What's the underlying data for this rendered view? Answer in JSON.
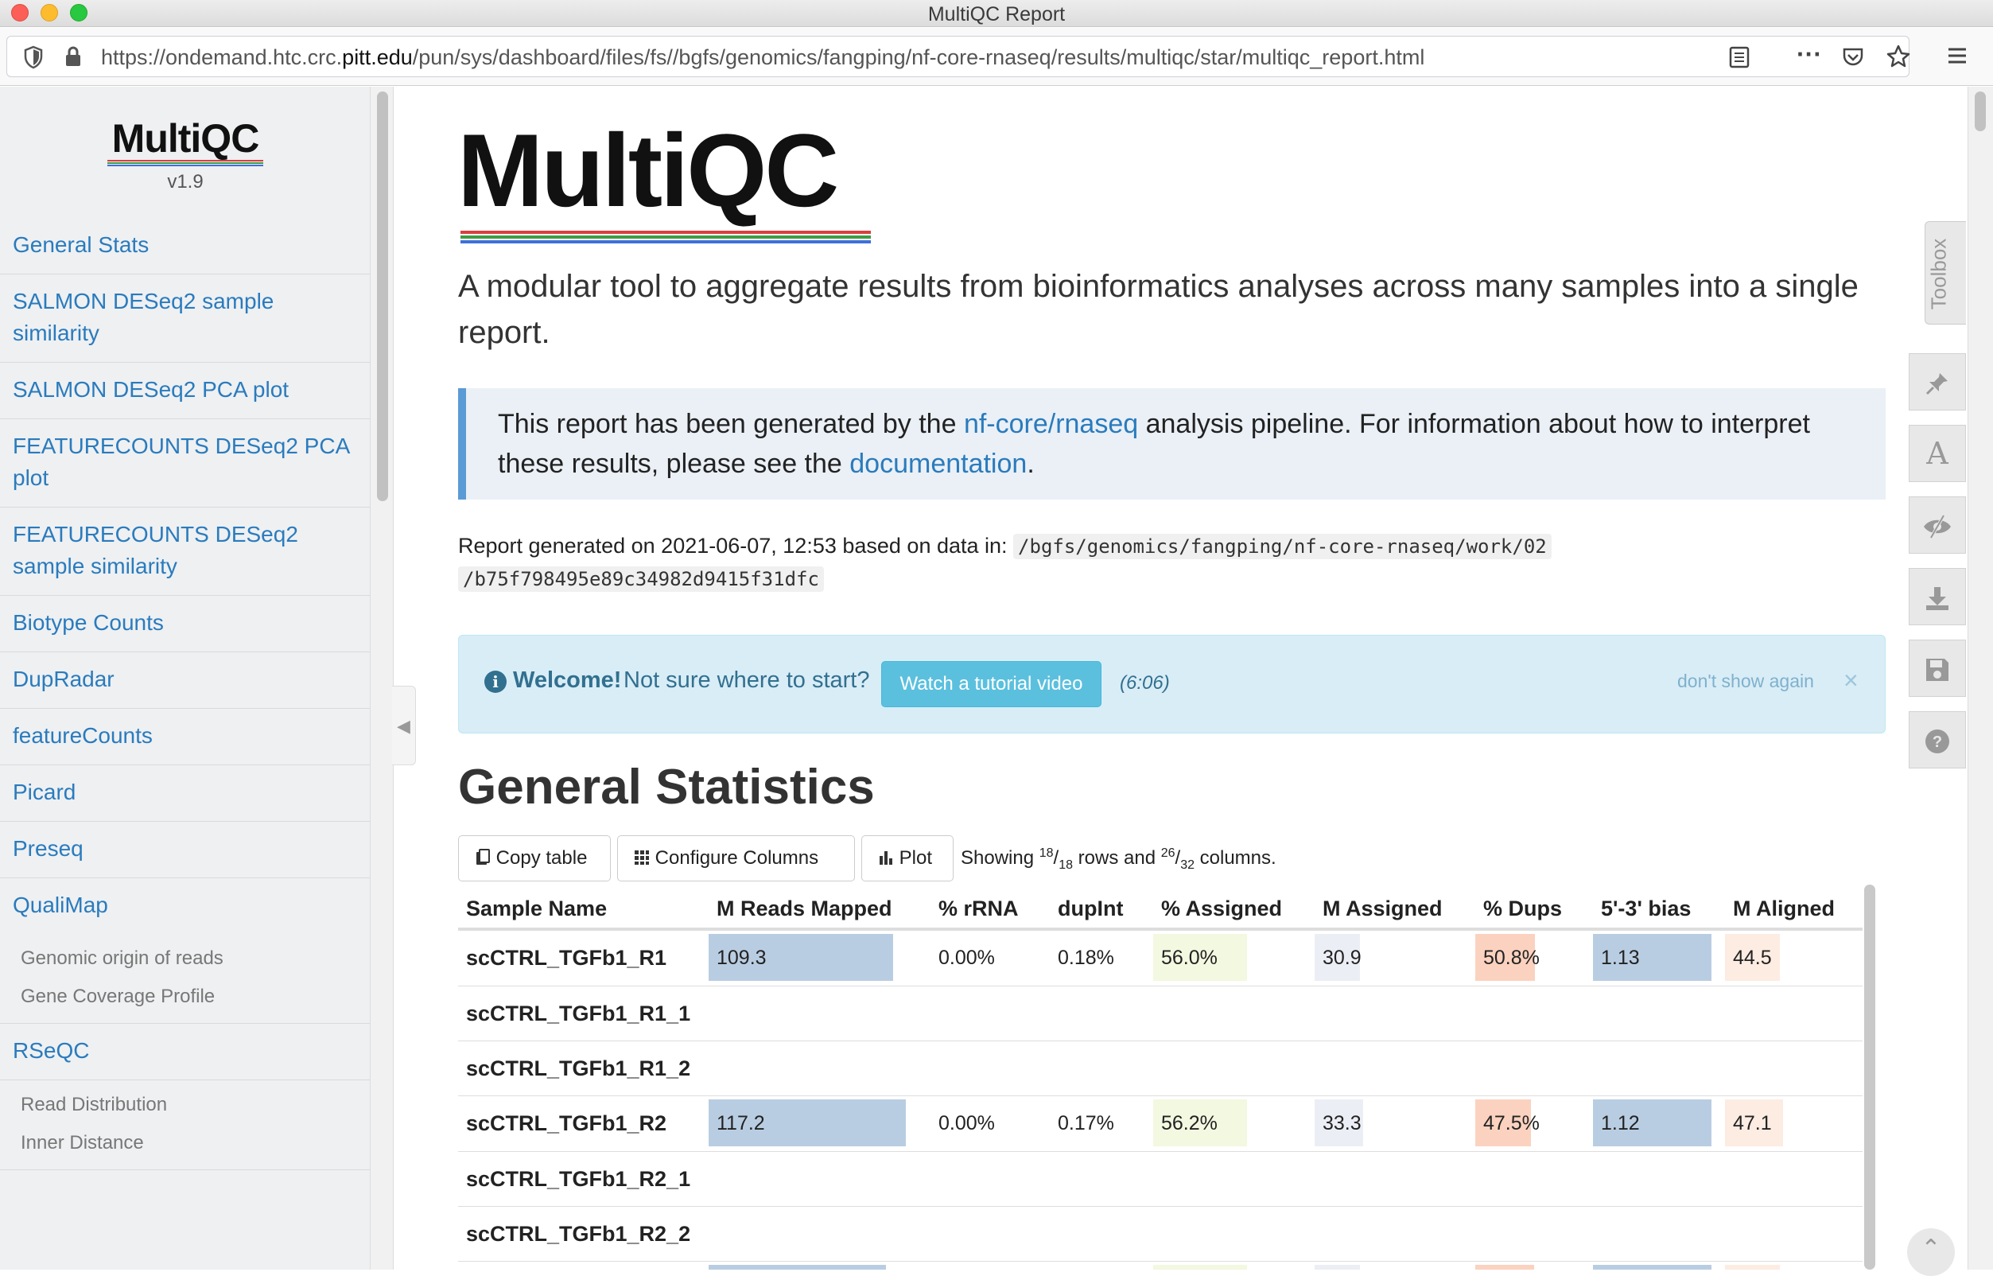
{
  "window": {
    "title": "MultiQC Report"
  },
  "browser": {
    "url_pre": "https://ondemand.htc.crc.",
    "url_host": "pitt.edu",
    "url_post": "/pun/sys/dashboard/files/fs//bgfs/genomics/fangping/nf-core-rnaseq/results/multiqc/star/multiqc_report.html"
  },
  "sidebar": {
    "logo_text": "MultiQC",
    "version": "v1.9",
    "items": [
      {
        "label": "General Stats"
      },
      {
        "label": "SALMON DESeq2 sample similarity"
      },
      {
        "label": "SALMON DESeq2 PCA plot"
      },
      {
        "label": "FEATURECOUNTS DESeq2 PCA plot"
      },
      {
        "label": "FEATURECOUNTS DESeq2 sample similarity"
      },
      {
        "label": "Biotype Counts"
      },
      {
        "label": "DupRadar"
      },
      {
        "label": "featureCounts"
      },
      {
        "label": "Picard"
      },
      {
        "label": "Preseq"
      },
      {
        "label": "QualiMap"
      },
      {
        "label": "RSeQC"
      }
    ],
    "qualimap_sub": [
      "Genomic origin of reads",
      "Gene Coverage Profile"
    ],
    "rseqc_sub": [
      "Read Distribution",
      "Inner Distance"
    ]
  },
  "main": {
    "logo_text": "MultiQC",
    "lead": "A modular tool to aggregate results from bioinformatics analyses across many samples into a single report.",
    "intro": {
      "t1": "This report has been generated by the ",
      "link1": "nf-core/rnaseq",
      "t2": " analysis pipeline. For information about how to interpret these results, please see the ",
      "link2": "documentation",
      "t3": "."
    },
    "generated": {
      "text": "Report generated on 2021-06-07, 12:53 based on data in: ",
      "path1": "/bgfs/genomics/fangping/nf-core-rnaseq/work/02",
      "path2": "/b75f798495e89c34982d9415f31dfc"
    },
    "welcome": {
      "strong": "Welcome!",
      "text": "Not sure where to start?",
      "button": "Watch a tutorial video",
      "duration": "(6:06)",
      "dismiss": "don't show again",
      "close": "×"
    },
    "heading": "General Statistics",
    "toolbar": {
      "copy": "Copy table",
      "configure": "Configure Columns",
      "plot": "Plot",
      "showing_pre": "Showing ",
      "rows_shown": "18",
      "rows_total": "18",
      "showing_mid": " rows and ",
      "cols_shown": "26",
      "cols_total": "32",
      "showing_post": " columns."
    }
  },
  "table": {
    "headers": [
      "Sample Name",
      "M Reads Mapped",
      "% rRNA",
      "dupInt",
      "% Assigned",
      "M Assigned",
      "% Dups",
      "5'-3' bias",
      "M Aligned"
    ],
    "rows": [
      {
        "name": "scCTRL_TGFb1_R1",
        "mapped": "109.3",
        "rrna": "0.00%",
        "dupint": "0.18%",
        "assigned": "56.0%",
        "massigned": "30.9",
        "dups": "50.8%",
        "bias": "1.13",
        "aligned": "44.5",
        "f_mapped": 0.83,
        "f_assigned": 0.58,
        "f_massigned": 0.28,
        "f_dups": 0.51,
        "f_bias": 0.9,
        "f_aligned": 0.4
      },
      {
        "name": "scCTRL_TGFb1_R1_1"
      },
      {
        "name": "scCTRL_TGFb1_R1_2"
      },
      {
        "name": "scCTRL_TGFb1_R2",
        "mapped": "117.2",
        "rrna": "0.00%",
        "dupint": "0.17%",
        "assigned": "56.2%",
        "massigned": "33.3",
        "dups": "47.5%",
        "bias": "1.12",
        "aligned": "47.1",
        "f_mapped": 0.89,
        "f_assigned": 0.58,
        "f_massigned": 0.3,
        "f_dups": 0.47,
        "f_bias": 0.9,
        "f_aligned": 0.42
      },
      {
        "name": "scCTRL_TGFb1_R2_1"
      },
      {
        "name": "scCTRL_TGFb1_R2_2"
      },
      {
        "name": "",
        "mapped": "",
        "f_mapped": 0.8,
        "f_assigned": 0.58,
        "f_massigned": 0.28,
        "f_dups": 0.5,
        "f_bias": 0.9,
        "f_aligned": 0.4
      }
    ],
    "bar_colors": {
      "mapped": "#b9cde2",
      "assigned": "#f3f8e0",
      "massigned": "#eceef5",
      "dups": "#fbd2bf",
      "bias": "#b9cde2",
      "aligned": "#fdece2"
    }
  },
  "toolbox": {
    "label": "Toolbox",
    "icons": [
      "pin-icon",
      "font-icon",
      "eye-slash-icon",
      "download-icon",
      "save-icon",
      "help-icon"
    ]
  },
  "colors": {
    "link": "#2a7bbd",
    "info_text": "#31708f",
    "info_btn": "#5bc0de"
  }
}
